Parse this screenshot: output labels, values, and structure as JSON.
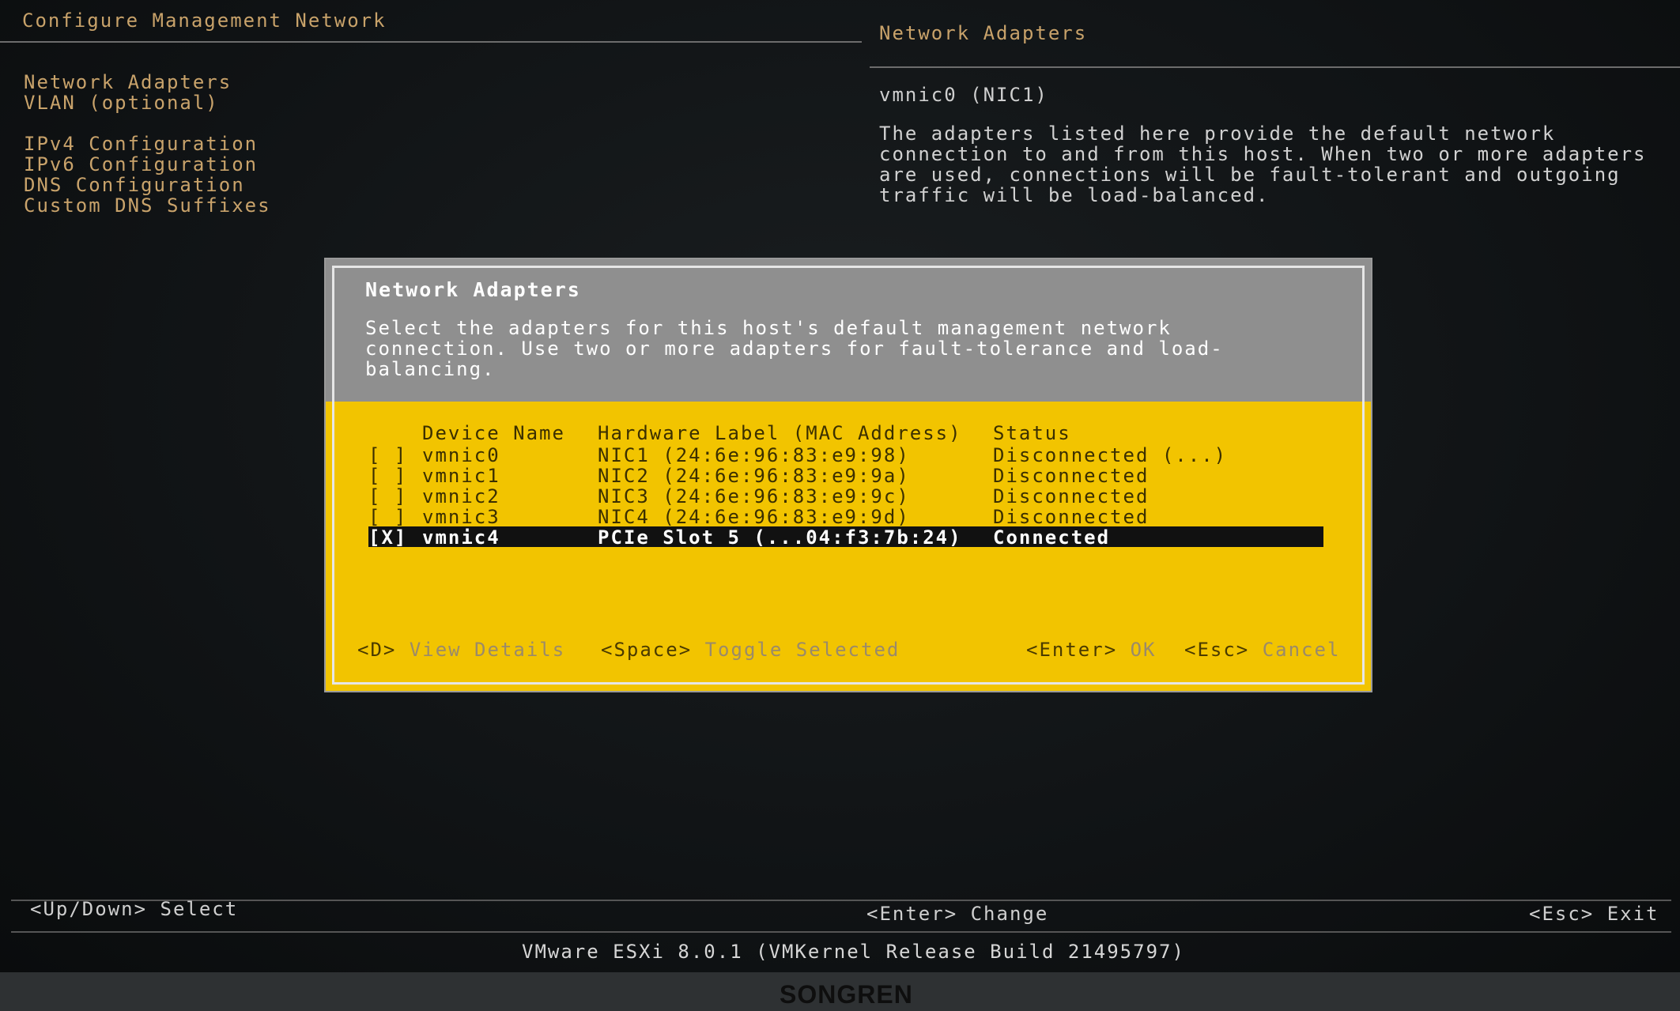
{
  "header": {
    "left_title": "Configure Management Network",
    "right_title": "Network Adapters"
  },
  "menu": {
    "items": [
      "Network Adapters",
      "VLAN (optional)",
      "IPv4 Configuration",
      "IPv6 Configuration",
      "DNS Configuration",
      "Custom DNS Suffixes"
    ]
  },
  "info": {
    "subtitle": "vmnic0 (NIC1)",
    "description": "The adapters listed here provide the default network connection to and from this host. When two or more adapters are used, connections will be fault-tolerant and outgoing traffic will be load-balanced."
  },
  "dialog": {
    "title": "Network Adapters",
    "description": "Select the adapters for this host's default management network connection. Use two or more adapters for fault-tolerance and load-balancing.",
    "columns": {
      "device": "Device Name",
      "hardware": "Hardware Label (MAC Address)",
      "status": "Status"
    },
    "rows": [
      {
        "check": "[ ]",
        "device": "vmnic0",
        "hardware": "NIC1 (24:6e:96:83:e9:98)",
        "status": "Disconnected (...)"
      },
      {
        "check": "[ ]",
        "device": "vmnic1",
        "hardware": "NIC2 (24:6e:96:83:e9:9a)",
        "status": "Disconnected"
      },
      {
        "check": "[ ]",
        "device": "vmnic2",
        "hardware": "NIC3 (24:6e:96:83:e9:9c)",
        "status": "Disconnected"
      },
      {
        "check": "[ ]",
        "device": "vmnic3",
        "hardware": "NIC4 (24:6e:96:83:e9:9d)",
        "status": "Disconnected"
      },
      {
        "check": "[X]",
        "device": "vmnic4",
        "hardware": "PCIe Slot 5 (...04:f3:7b:24)",
        "status": "Connected"
      }
    ],
    "footer": {
      "view_key": "<D>",
      "view_label": "View Details",
      "toggle_key": "<Space>",
      "toggle_label": "Toggle Selected",
      "ok_key": "<Enter>",
      "ok_label": "OK",
      "cancel_key": "<Esc>",
      "cancel_label": "Cancel"
    }
  },
  "bottom": {
    "select_hint": "<Up/Down> Select",
    "change_hint": "<Enter> Change",
    "exit_hint": "<Esc> Exit",
    "version": "VMware ESXi 8.0.1 (VMKernel Release Build 21495797)"
  },
  "bezel": {
    "brand": "SONGREN"
  },
  "colors": {
    "background": "#101315",
    "dialog_gray": "#8f8f8f",
    "dialog_yellow": "#f2c400",
    "selected_row": "#111111",
    "menu_text": "#c9a36b"
  }
}
